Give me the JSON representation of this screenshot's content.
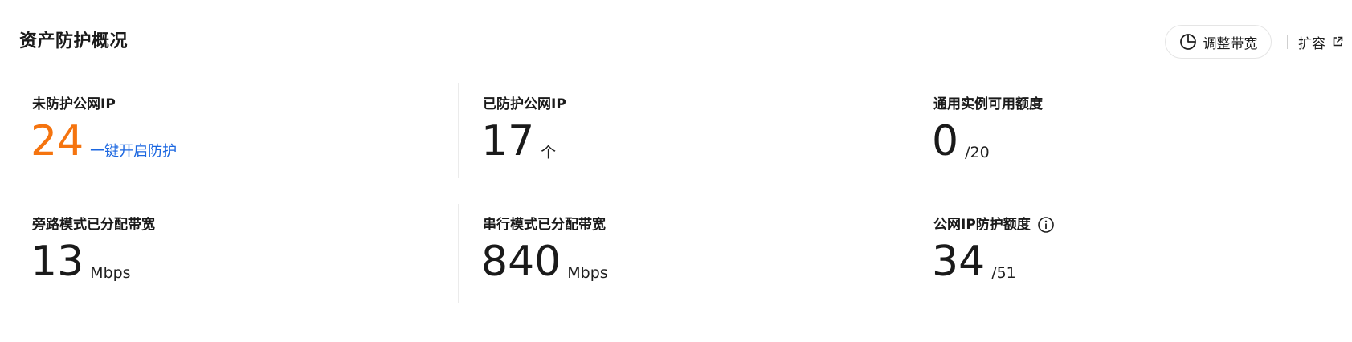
{
  "header": {
    "title": "资产防护概况",
    "adjust_bandwidth_label": "调整带宽",
    "adjust_bandwidth_icon": "pie-chart-icon",
    "expand_label": "扩容",
    "expand_icon": "external-link-icon"
  },
  "cards": [
    {
      "label": "未防护公网IP",
      "value": "24",
      "suffix": "一键开启防护",
      "value_color": "#f5740f",
      "suffix_color": "#1a66e0"
    },
    {
      "label": "已防护公网IP",
      "value": "17",
      "suffix": "个"
    },
    {
      "label": "通用实例可用额度",
      "value": "0",
      "suffix": "/20"
    },
    {
      "label": "旁路模式已分配带宽",
      "value": "13",
      "suffix": "Mbps"
    },
    {
      "label": "串行模式已分配带宽",
      "value": "840",
      "suffix": "Mbps"
    },
    {
      "label": "公网IP防护额度",
      "value": "34",
      "suffix": "/51",
      "info_icon": "info-circle-icon"
    }
  ]
}
